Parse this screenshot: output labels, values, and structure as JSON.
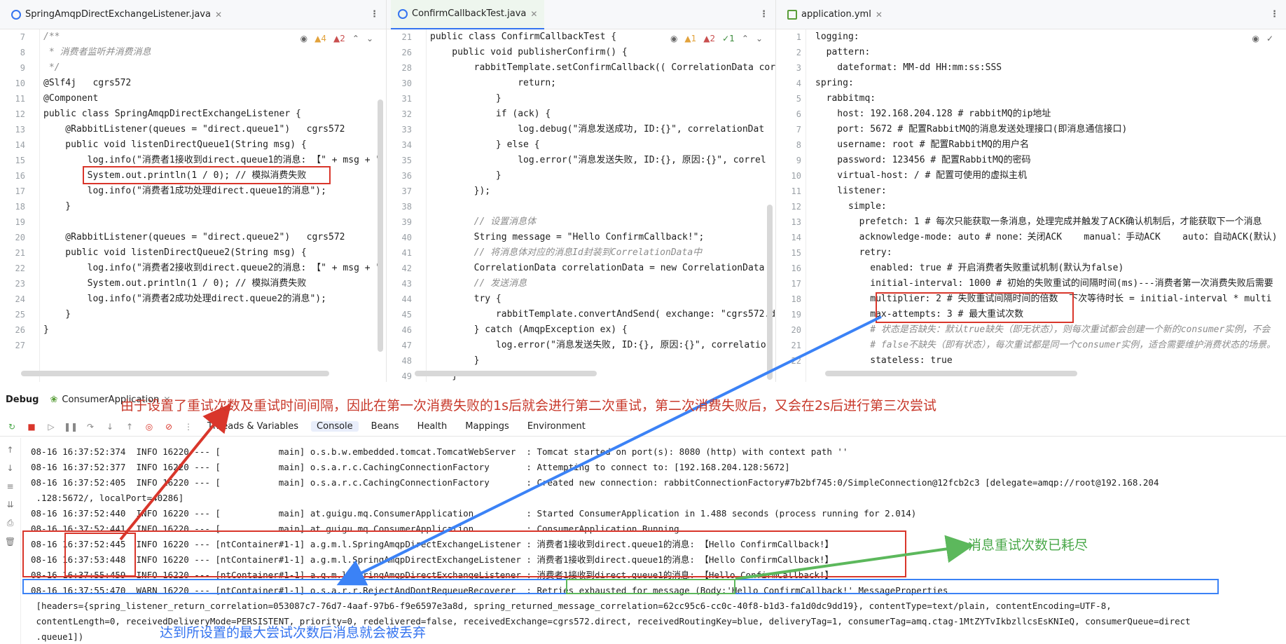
{
  "panes": {
    "left": {
      "tab": "SpringAmqpDirectExchangeListener.java",
      "indicators": {
        "warnings": "4",
        "errors": "2"
      },
      "lines": [
        {
          "n": "7",
          "t": "/**"
        },
        {
          "n": "8",
          "t": " * 消费者监听并消费消息"
        },
        {
          "n": "9",
          "t": " */"
        },
        {
          "n": "10",
          "t": "@Slf4j   cgrs572"
        },
        {
          "n": "11",
          "t": "@Component"
        },
        {
          "n": "12",
          "t": "public class SpringAmqpDirectExchangeListener {"
        },
        {
          "n": "13",
          "t": "    @RabbitListener(queues = \"direct.queue1\")   cgrs572"
        },
        {
          "n": "14",
          "t": "    public void listenDirectQueue1(String msg) {"
        },
        {
          "n": "15",
          "t": "        log.info(\"消费者1接收到direct.queue1的消息: 【\" + msg + \""
        },
        {
          "n": "16",
          "t": "        System.out.println(1 / 0); // 模拟消费失败"
        },
        {
          "n": "17",
          "t": "        log.info(\"消费者1成功处理direct.queue1的消息\");"
        },
        {
          "n": "18",
          "t": "    }"
        },
        {
          "n": "19",
          "t": ""
        },
        {
          "n": "20",
          "t": "    @RabbitListener(queues = \"direct.queue2\")   cgrs572"
        },
        {
          "n": "21",
          "t": "    public void listenDirectQueue2(String msg) {"
        },
        {
          "n": "22",
          "t": "        log.info(\"消费者2接收到direct.queue2的消息: 【\" + msg + \""
        },
        {
          "n": "23",
          "t": "        System.out.println(1 / 0); // 模拟消费失败"
        },
        {
          "n": "24",
          "t": "        log.info(\"消费者2成功处理direct.queue2的消息\");"
        },
        {
          "n": "25",
          "t": "    }"
        },
        {
          "n": "26",
          "t": "}"
        },
        {
          "n": "27",
          "t": ""
        }
      ]
    },
    "middle": {
      "tab": "ConfirmCallbackTest.java",
      "indicators": {
        "warnings": "1",
        "errors": "2",
        "ok": "1"
      },
      "lines": [
        {
          "n": "21",
          "t": "public class ConfirmCallbackTest {"
        },
        {
          "n": "26",
          "t": "    public void publisherConfirm() {"
        },
        {
          "n": "28",
          "t": "        rabbitTemplate.setConfirmCallback(( CorrelationData corr"
        },
        {
          "n": "30",
          "t": "                return;"
        },
        {
          "n": "31",
          "t": "            }"
        },
        {
          "n": "32",
          "t": "            if (ack) {"
        },
        {
          "n": "33",
          "t": "                log.debug(\"消息发送成功, ID:{}\", correlationDat"
        },
        {
          "n": "34",
          "t": "            } else {"
        },
        {
          "n": "35",
          "t": "                log.error(\"消息发送失败, ID:{}, 原因:{}\", correl"
        },
        {
          "n": "36",
          "t": "            }"
        },
        {
          "n": "37",
          "t": "        });"
        },
        {
          "n": "38",
          "t": ""
        },
        {
          "n": "39",
          "t": "        // 设置消息体"
        },
        {
          "n": "40",
          "t": "        String message = \"Hello ConfirmCallback!\";"
        },
        {
          "n": "41",
          "t": "        // 将消息体对应的消息Id封装到CorrelationData中"
        },
        {
          "n": "42",
          "t": "        CorrelationData correlationData = new CorrelationData"
        },
        {
          "n": "43",
          "t": "        // 发送消息"
        },
        {
          "n": "44",
          "t": "        try {"
        },
        {
          "n": "45",
          "t": "            rabbitTemplate.convertAndSend( exchange: \"cgrs572.d"
        },
        {
          "n": "46",
          "t": "        } catch (AmqpException ex) {"
        },
        {
          "n": "47",
          "t": "            log.error(\"消息发送失败, ID:{}, 原因:{}\", correlatio"
        },
        {
          "n": "48",
          "t": "        }"
        },
        {
          "n": "49",
          "t": "    }"
        }
      ]
    },
    "right": {
      "tab": "application.yml",
      "lines": [
        {
          "n": "1",
          "t": "logging:"
        },
        {
          "n": "2",
          "t": "  pattern:"
        },
        {
          "n": "3",
          "t": "    dateformat: MM-dd HH:mm:ss:SSS"
        },
        {
          "n": "4",
          "t": "spring:"
        },
        {
          "n": "5",
          "t": "  rabbitmq:"
        },
        {
          "n": "6",
          "t": "    host: 192.168.204.128 # rabbitMQ的ip地址"
        },
        {
          "n": "7",
          "t": "    port: 5672 # 配置RabbitMQ的消息发送处理接口(即消息通信接口)"
        },
        {
          "n": "8",
          "t": "    username: root # 配置RabbitMQ的用户名"
        },
        {
          "n": "9",
          "t": "    password: 123456 # 配置RabbitMQ的密码"
        },
        {
          "n": "10",
          "t": "    virtual-host: / # 配置可使用的虚拟主机"
        },
        {
          "n": "11",
          "t": "    listener:"
        },
        {
          "n": "12",
          "t": "      simple:"
        },
        {
          "n": "13",
          "t": "        prefetch: 1 # 每次只能获取一条消息，处理完成并触发了ACK确认机制后，才能获取下一个消息"
        },
        {
          "n": "14",
          "t": "        acknowledge-mode: auto # none：关闭ACK    manual：手动ACK    auto：自动ACK(默认)"
        },
        {
          "n": "15",
          "t": "        retry:"
        },
        {
          "n": "16",
          "t": "          enabled: true # 开启消费者失败重试机制(默认为false)"
        },
        {
          "n": "17",
          "t": "          initial-interval: 1000 # 初始的失败重试的间隔时间(ms)---消费者第一次消费失败后需要"
        },
        {
          "n": "18",
          "t": "          multiplier: 2 # 失败重试间隔时间的倍数  下次等待时长 = initial-interval * multi"
        },
        {
          "n": "19",
          "t": "          max-attempts: 3 # 最大重试次数"
        },
        {
          "n": "20",
          "t": "          # 状态是否缺失：默认true缺失（即无状态），则每次重试都会创建一个新的consumer实例，不会"
        },
        {
          "n": "21",
          "t": "          # false不缺失（即有状态），每次重试都是同一个consumer实例，适合需要维护消费状态的场景。"
        },
        {
          "n": "22",
          "t": "          stateless: true"
        }
      ]
    }
  },
  "debug": {
    "title": "Debug",
    "config": "ConsumerApplication",
    "tabs": [
      "Threads & Variables",
      "Console",
      "Beans",
      "Health",
      "Mappings",
      "Environment"
    ]
  },
  "console": {
    "lines": [
      "08-16 16:37:52:374  INFO 16220 --- [           main] o.s.b.w.embedded.tomcat.TomcatWebServer  : Tomcat started on port(s): 8080 (http) with context path ''",
      "08-16 16:37:52:377  INFO 16220 --- [           main] o.s.a.r.c.CachingConnectionFactory       : Attempting to connect to: [192.168.204.128:5672]",
      "08-16 16:37:52:405  INFO 16220 --- [           main] o.s.a.r.c.CachingConnectionFactory       : Created new connection: rabbitConnectionFactory#7b2bf745:0/SimpleConnection@12fcb2c3 [delegate=amqp://root@192.168.204",
      " .128:5672/, localPort=40286]",
      "08-16 16:37:52:440  INFO 16220 --- [           main] at.guigu.mq.ConsumerApplication          : Started ConsumerApplication in 1.488 seconds (process running for 2.014)",
      "08-16 16:37:52:441  INFO 16220 --- [           main] at.guigu.mq.ConsumerApplication          : ConsumerApplication Running",
      "08-16 16:37:52:445  INFO 16220 --- [ntContainer#1-1] a.g.m.l.SpringAmqpDirectExchangeListener : 消费者1接收到direct.queue1的消息: 【Hello ConfirmCallback!】",
      "08-16 16:37:53:448  INFO 16220 --- [ntContainer#1-1] a.g.m.l.SpringAmqpDirectExchangeListener : 消费者1接收到direct.queue1的消息: 【Hello ConfirmCallback!】",
      "08-16 16:37:55:459  INFO 16220 --- [ntContainer#1-1] a.g.m.l.SpringAmqpDirectExchangeListener : 消费者1接收到direct.queue1的消息: 【Hello ConfirmCallback!】",
      "08-16 16:37:55:470  WARN 16220 --- [ntContainer#1-1] o.s.a.r.r.RejectAndDontRequeueRecoverer  : Retries exhausted for message (Body:'Hello ConfirmCallback!' MessageProperties",
      " [headers={spring_listener_return_correlation=053087c7-76d7-4aaf-97b6-f9e6597e3a8d, spring_returned_message_correlation=62cc95c6-cc0c-40f8-b1d3-fa1d0dc9dd19}, contentType=text/plain, contentEncoding=UTF-8,",
      " contentLength=0, receivedDeliveryMode=PERSISTENT, priority=0, redelivered=false, receivedExchange=cgrs572.direct, receivedRoutingKey=blue, deliveryTag=1, consumerTag=amq.ctag-1MtZYTvIkbzllcsEsKNIeQ, consumerQueue=direct",
      " .queue1])"
    ]
  },
  "annotations": {
    "top": "由于设置了重试次数及重试时间间隔，因此在第一次消费失败的1s后就会进行第二次重试，第二次消费失败后，又会在2s后进行第三次尝试",
    "right": "消息重试次数已耗尽",
    "bottom": "达到所设置的最大尝试次数后消息就会被丢弃"
  },
  "colors": {
    "red": "#d9362b",
    "blue": "#3b82f6",
    "green": "#5cb85c"
  }
}
